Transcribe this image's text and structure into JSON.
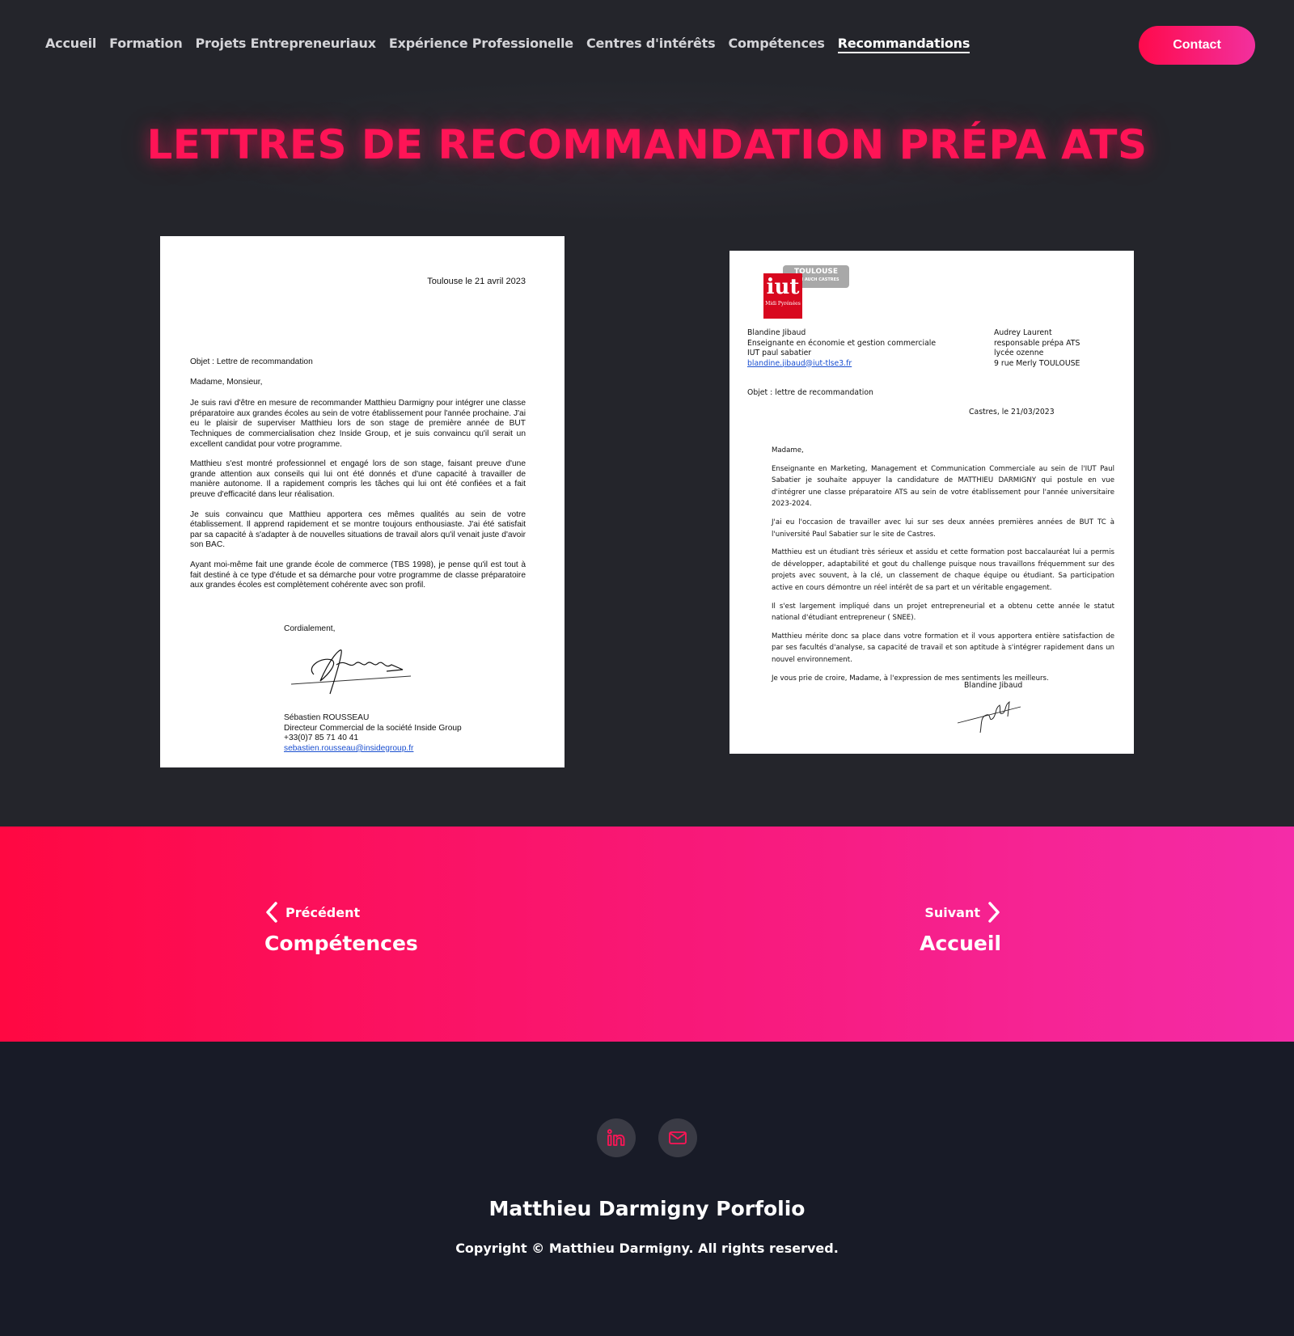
{
  "nav": {
    "items": [
      {
        "label": "Accueil",
        "active": false
      },
      {
        "label": "Formation",
        "active": false
      },
      {
        "label": "Projets Entrepreneuriaux",
        "active": false
      },
      {
        "label": "Expérience Professionelle",
        "active": false
      },
      {
        "label": "Centres d'intérêts",
        "active": false
      },
      {
        "label": "Compétences",
        "active": false
      },
      {
        "label": "Recommandations",
        "active": true
      }
    ],
    "contact_label": "Contact"
  },
  "page_title": "LETTRES DE RECOMMANDATION PRÉPA ATS",
  "letter1": {
    "date": "Toulouse le 21 avril 2023",
    "objet": "Objet : Lettre de recommandation",
    "salutation": "Madame, Monsieur,",
    "paragraphs": [
      "Je suis ravi d'être en mesure de recommander Matthieu Darmigny pour intégrer une classe préparatoire aux grandes écoles au sein de votre établissement pour l'année prochaine. J'ai eu le plaisir de superviser Matthieu lors de son stage de première année de BUT Techniques de commercialisation chez Inside Group, et je suis convaincu qu'il serait un excellent candidat pour votre programme.",
      "Matthieu s'est montré professionnel et engagé lors de son stage, faisant preuve d'une grande attention aux conseils qui lui ont été donnés et d'une capacité à travailler de manière autonome. Il a rapidement compris les tâches qui lui ont été confiées et a fait preuve d'efficacité dans leur réalisation.",
      "Je suis convaincu que Matthieu apportera ces mêmes qualités au sein de votre établissement. Il apprend rapidement et se montre toujours enthousiaste. J'ai été satisfait par sa capacité à s'adapter à de nouvelles situations de travail alors qu'il venait juste d'avoir son BAC.",
      "Ayant moi-même fait une grande école de commerce (TBS 1998), je pense qu'il est tout à fait destiné à ce type d'étude et sa démarche pour votre programme de classe préparatoire aux grandes écoles est complètement cohérente avec son profil."
    ],
    "closing": "Cordialement,",
    "signer_name": "Sébastien ROUSSEAU",
    "signer_title": "Directeur Commercial de la société Inside Group",
    "signer_phone": "+33(0)7 85 71 40 41",
    "signer_email": "sebastien.rousseau@insidegroup.fr"
  },
  "letter2": {
    "logo_main": "iut",
    "logo_sub": "Midi Pyrénées",
    "logo_city": "TOULOUSE",
    "logo_city_sub": "ALBI AUCH CASTRES",
    "from": [
      "Blandine Jibaud",
      "Enseignante en économie et gestion commerciale",
      "IUT paul sabatier"
    ],
    "from_email": "blandine.jibaud@iut-tlse3.fr",
    "to": [
      "Audrey Laurent",
      "responsable prépa ATS",
      "lycée ozenne",
      "9 rue Merly TOULOUSE"
    ],
    "objet": "Objet : lettre de recommandation",
    "date": "Castres, le 21/03/2023",
    "salutation": "Madame,",
    "paragraphs": [
      "Enseignante en Marketing, Management et Communication Commerciale au sein de l'IUT Paul Sabatier je souhaite appuyer la candidature de MATTHIEU DARMIGNY qui postule en vue d'intégrer une classe préparatoire ATS au sein de votre établissement pour l'année universitaire 2023-2024.",
      "J'ai eu l'occasion de travailler avec lui sur ses deux années premières années de BUT TC à l'université Paul Sabatier sur le site de Castres.",
      "Matthieu est un étudiant très sérieux et assidu et cette formation post baccalauréat lui a permis de développer, adaptabilité et gout du challenge puisque nous travaillons fréquemment sur des projets avec souvent, à la clé, un classement de chaque équipe ou étudiant. Sa participation active en cours démontre un réel intérêt de sa part et un véritable engagement.",
      "Il s'est largement impliqué dans un projet entrepreneurial et a obtenu cette année le statut national d'étudiant entrepreneur ( SNEE).",
      "Matthieu mérite donc sa place dans votre formation et il vous apportera entière satisfaction de par ses facultés d'analyse, sa capacité de travail et son aptitude à s'intégrer rapidement dans un nouvel environnement.",
      "Je vous prie de croire, Madame, à l'expression de mes sentiments les meilleurs."
    ],
    "signer_name": "Blandine Jibaud"
  },
  "pager": {
    "prev_label": "Précédent",
    "prev_title": "Compétences",
    "next_label": "Suivant",
    "next_title": "Accueil"
  },
  "footer": {
    "socials": [
      {
        "icon": "linkedin-icon"
      },
      {
        "icon": "mail-icon"
      }
    ],
    "name": "Matthieu Darmigny Porfolio",
    "copyright": "Copyright © Matthieu Darmigny. All rights reserved."
  },
  "colors": {
    "accent": "#ff1456",
    "gradient_start": "#ff0842",
    "gradient_end": "#f42ca8",
    "page_bg": "#24252b",
    "footer_bg": "#181b27"
  }
}
